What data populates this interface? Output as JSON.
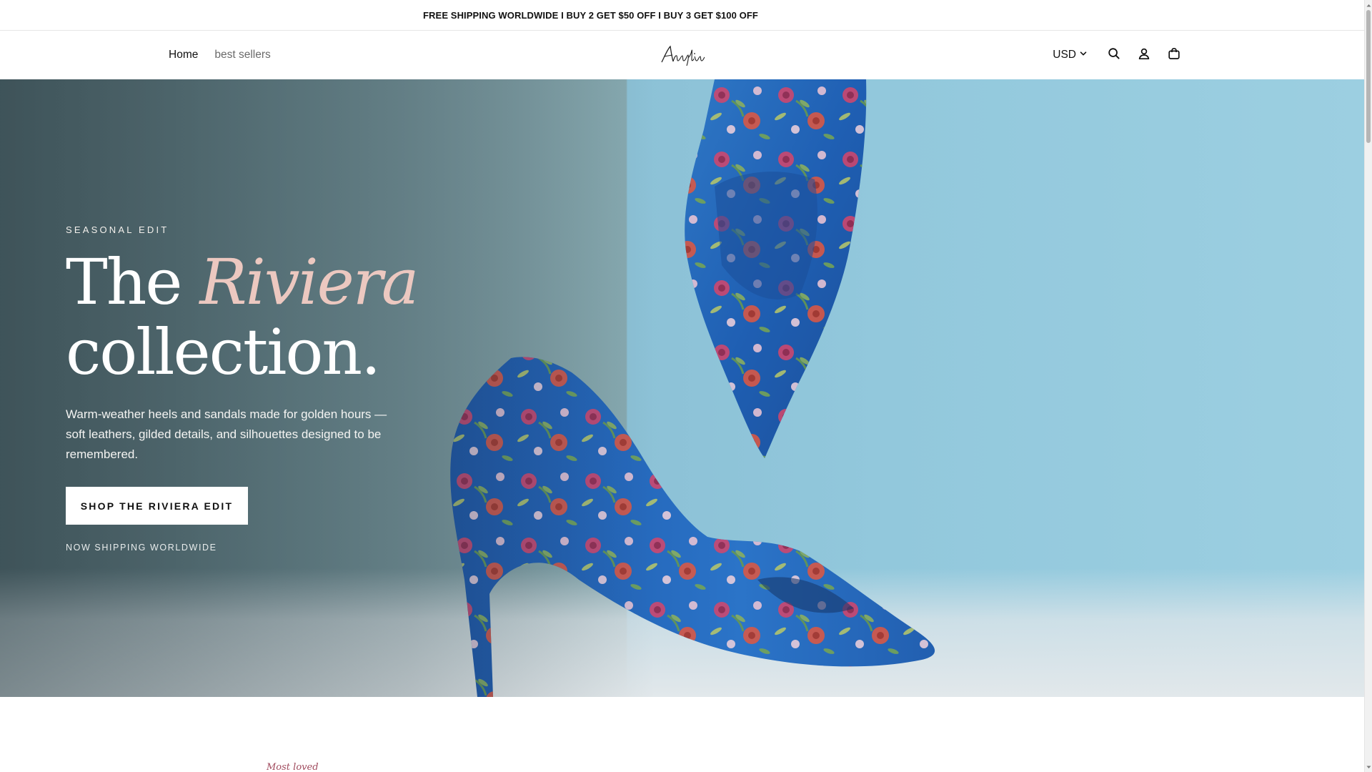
{
  "announcement": {
    "text": "FREE SHIPPING WORLDWIDE I BUY 2 GET $50 OFF I BUY 3 GET $100 OFF"
  },
  "nav": {
    "items": [
      {
        "label": "Home"
      },
      {
        "label": "best sellers"
      }
    ]
  },
  "header": {
    "logo_text": "Avaylia",
    "currency": "USD",
    "icons": {
      "search": "search-icon",
      "account": "user-icon",
      "cart": "shopping-bag-icon",
      "currency_caret": "chevron-down-icon"
    }
  },
  "hero": {
    "eyebrow": "SEASONAL EDIT",
    "headline_before": "The ",
    "headline_accent": "Riviera",
    "headline_after": "collection.",
    "body": "Warm-weather heels and sandals made for golden hours — soft leathers, gilded details, and silhouettes designed to be remembered.",
    "cta_label": "SHOP THE RIVIERA EDIT",
    "subnote": "NOW SHIPPING WORLDWIDE"
  },
  "section": {
    "eyebrow": "Most loved"
  },
  "colors": {
    "accent_pink": "#ecc8c0",
    "brand_text": "#111111",
    "hero_wall": "#8cc1d6",
    "section_accent": "#a04a5d"
  }
}
